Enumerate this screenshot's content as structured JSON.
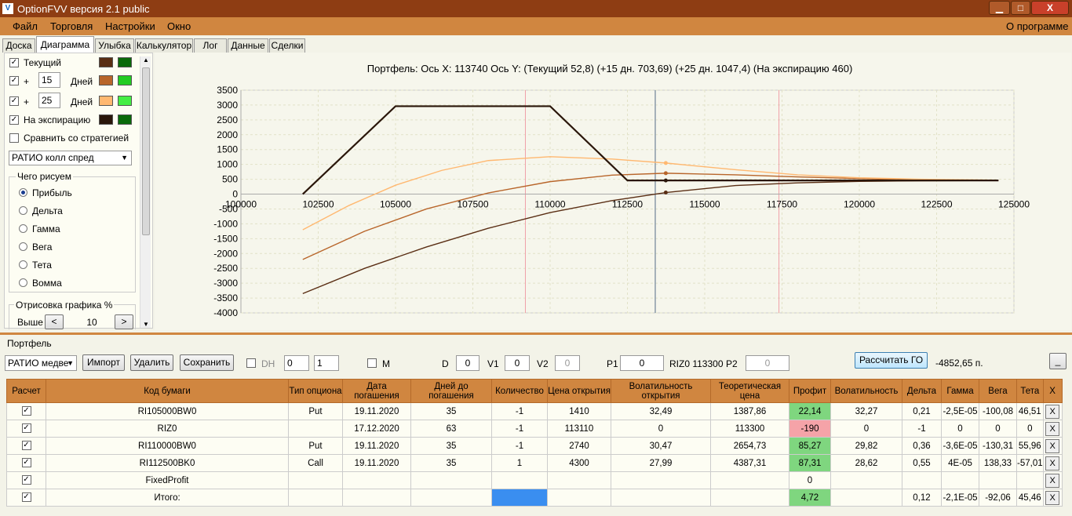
{
  "window": {
    "title": "OptionFVV версия 2.1 public",
    "min": "▁",
    "max": "□",
    "close": "X"
  },
  "menu": {
    "file": "Файл",
    "trade": "Торговля",
    "settings": "Настройки",
    "window": "Окно",
    "about": "О программе"
  },
  "tabs": [
    "Доска",
    "Диаграмма",
    "Улыбка",
    "Калькулятор",
    "Лог",
    "Данные",
    "Сделки"
  ],
  "left": {
    "current": "Текущий",
    "plus": "+",
    "days_a": "15",
    "days_b": "25",
    "days": "Дней",
    "expiry": "На экспирацию",
    "compare": "Сравнить со стратегией",
    "strategy": "РАТИО колл спред",
    "what_draw": "Чего рисуем",
    "radios": [
      "Прибыль",
      "Дельта",
      "Гамма",
      "Вега",
      "Тета",
      "Вомма"
    ],
    "render_pct": "Отрисовка графика %",
    "higher": "Выше",
    "render_val": "10",
    "lt": "<",
    "gt": ">"
  },
  "chart_data": {
    "type": "line",
    "title": "Портфель: Ось X: 113740 Ось Y:  (Текущий 52,8)  (+15 дн. 703,69)  (+25 дн. 1047,4)  (На экспирацию 460)",
    "xlim": [
      100000,
      125000
    ],
    "ylim": [
      -4000,
      3500
    ],
    "xticks": [
      "100000",
      "102500",
      "105000",
      "107500",
      "110000",
      "112500",
      "115000",
      "117500",
      "120000",
      "122500",
      "125000"
    ],
    "yticks": [
      "3500",
      "3000",
      "2500",
      "2000",
      "1500",
      "1000",
      "500",
      "0",
      "-500",
      "-1000",
      "-1500",
      "-2000",
      "-2500",
      "-3000",
      "-3500",
      "-4000"
    ],
    "cursor_x": 113400,
    "marker_x": 113740,
    "red_lines": [
      109200,
      117400
    ],
    "colors": {
      "current": "#5a2e14",
      "plus15": "#b8652a",
      "plus25": "#ffb870",
      "expiry": "#2a160a"
    },
    "series": [
      {
        "key": "current",
        "x": [
          102000,
          104000,
          106000,
          108000,
          110000,
          112000,
          113740,
          116000,
          118000,
          120000,
          122000,
          124500
        ],
        "y": [
          -3350,
          -2500,
          -1780,
          -1150,
          -620,
          -220,
          52.8,
          290,
          380,
          430,
          450,
          460
        ]
      },
      {
        "key": "plus15",
        "x": [
          102000,
          104000,
          106000,
          108000,
          110000,
          112000,
          113740,
          116000,
          118000,
          120000,
          122000,
          124500
        ],
        "y": [
          -2200,
          -1250,
          -500,
          40,
          420,
          640,
          703.69,
          650,
          580,
          520,
          480,
          465
        ]
      },
      {
        "key": "plus25",
        "x": [
          102000,
          103500,
          105000,
          106500,
          108000,
          110000,
          112000,
          113740,
          116000,
          118000,
          120000,
          122000,
          124500
        ],
        "y": [
          -1200,
          -380,
          300,
          800,
          1130,
          1260,
          1180,
          1047.4,
          820,
          650,
          550,
          500,
          470
        ]
      },
      {
        "key": "expiry",
        "x": [
          102000,
          105000,
          110000,
          112500,
          124500
        ],
        "y": [
          0,
          2960,
          2960,
          460,
          460
        ]
      }
    ]
  },
  "bottom": {
    "title": "Портфель",
    "portfolio_select": "РАТИО медве",
    "import": "Импорт",
    "delete": "Удалить",
    "save": "Сохранить",
    "dh": "DH",
    "spin1": "0",
    "spin2": "1",
    "m": "M",
    "d_label": "D",
    "d_val": "0",
    "v1_label": "V1",
    "v1_val": "0",
    "v2_label": "V2",
    "v2_val": "0",
    "p1_label": "P1",
    "p1_val": "0",
    "riz_info": "RIZ0 113300",
    "p2_label": "P2",
    "p2_val": "0",
    "calc_go": "Рассчитать ГО",
    "go_value": "-4852,65 п.",
    "minimize": "_"
  },
  "table": {
    "headers": [
      "Расчет",
      "Код бумаги",
      "Тип опциона",
      "Дата погашения",
      "Дней до погашения",
      "Количество",
      "Цена открытия",
      "Волатильность открытия",
      "Теоретическая цена",
      "Профит",
      "Волатильность",
      "Дельта",
      "Гамма",
      "Вега",
      "Тета",
      "X"
    ],
    "rows": [
      [
        "RI105000BW0",
        "Put",
        "19.11.2020",
        "35",
        "-1",
        "1410",
        "32,49",
        "1387,86",
        "22,14",
        "32,27",
        "0,21",
        "-2,5E-05",
        "-100,08",
        "46,51"
      ],
      [
        "RIZ0",
        "",
        "17.12.2020",
        "63",
        "-1",
        "113110",
        "0",
        "113300",
        "-190",
        "0",
        "-1",
        "0",
        "0",
        "0"
      ],
      [
        "RI110000BW0",
        "Put",
        "19.11.2020",
        "35",
        "-1",
        "2740",
        "30,47",
        "2654,73",
        "85,27",
        "29,82",
        "0,36",
        "-3,6E-05",
        "-130,31",
        "55,96"
      ],
      [
        "RI112500BK0",
        "Call",
        "19.11.2020",
        "35",
        "1",
        "4300",
        "27,99",
        "4387,31",
        "87,31",
        "28,62",
        "0,55",
        "4E-05",
        "138,33",
        "-57,01"
      ],
      [
        "FixedProfit",
        "",
        "",
        "",
        "",
        "",
        "",
        "",
        "0",
        "",
        "",
        "",
        "",
        ""
      ],
      [
        "Итого:",
        "",
        "",
        "",
        "",
        "",
        "",
        "",
        "4,72",
        "",
        "0,12",
        "-2,1E-05",
        "-92,06",
        "45,46"
      ]
    ],
    "check": "✓",
    "x": "X"
  }
}
